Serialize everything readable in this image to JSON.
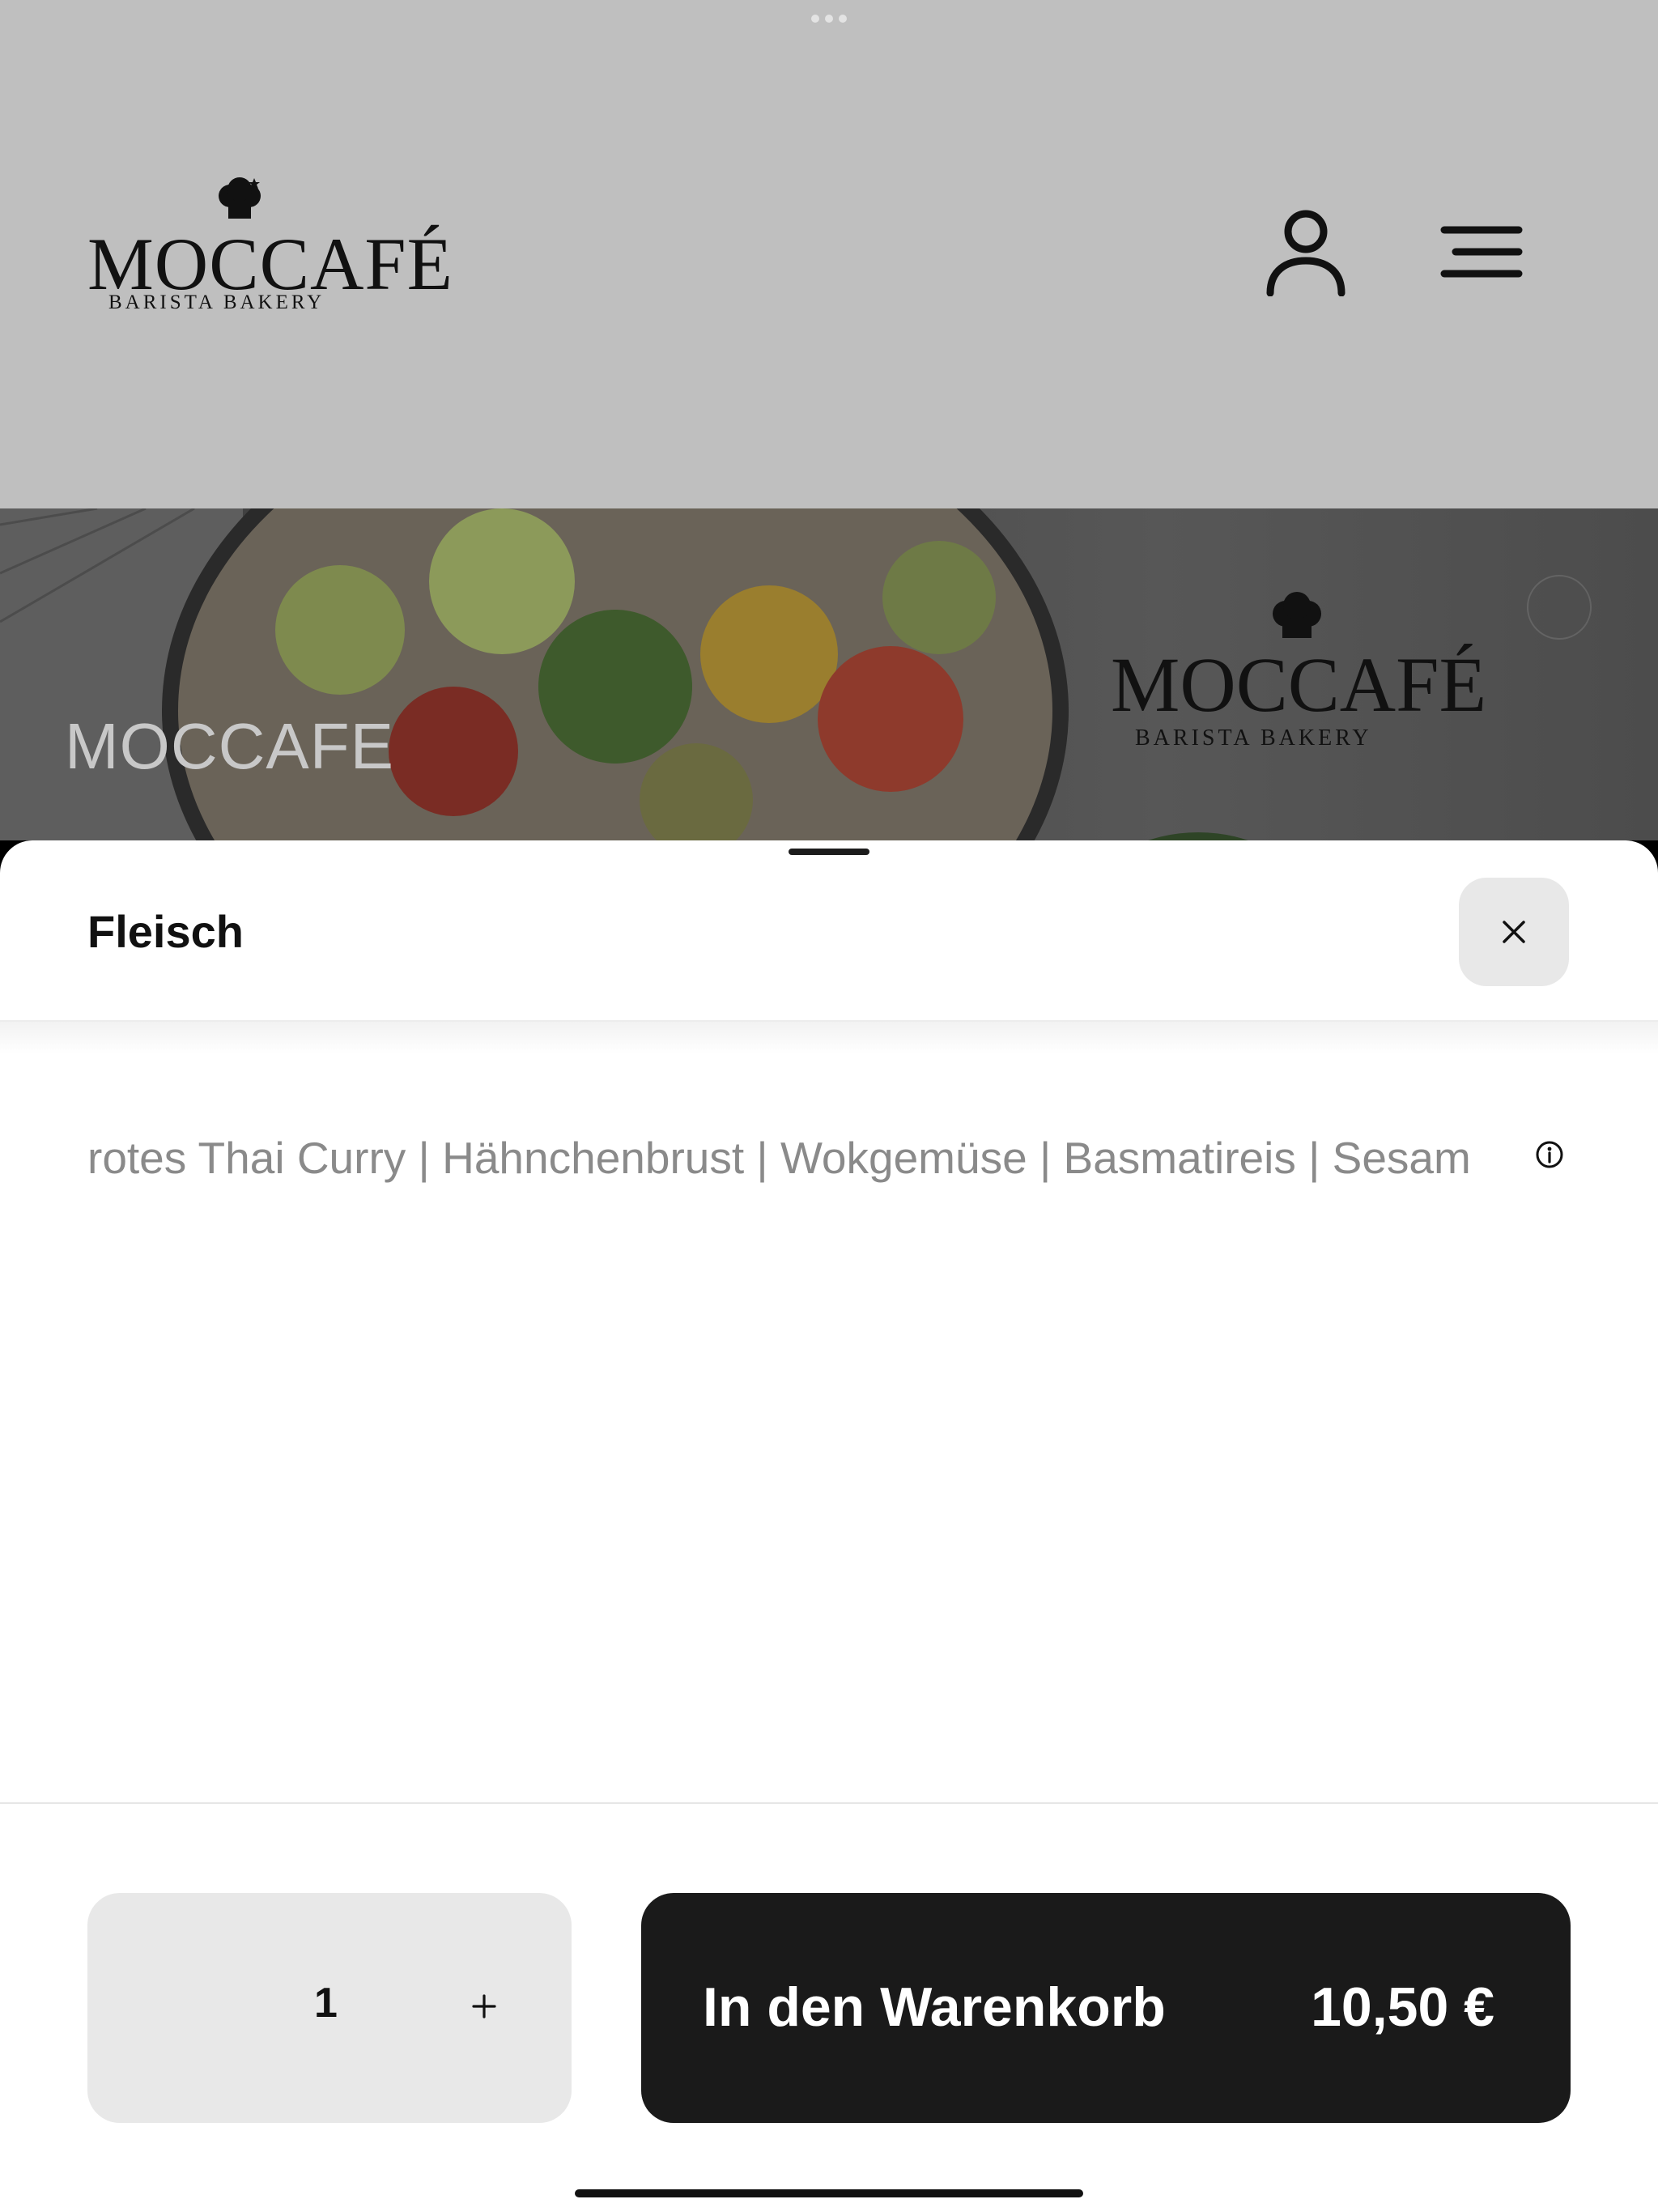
{
  "header": {
    "logo_text": "MOCCAFÉ",
    "logo_subtext": "BARISTA BAKERY",
    "account_icon": "user-icon",
    "menu_icon": "hamburger-menu-icon"
  },
  "hero": {
    "title": "MOCCAFE",
    "logo_text": "MOCCAFÉ",
    "logo_subtext": "BARISTA BAKERY"
  },
  "sheet": {
    "title": "Fleisch",
    "close_icon": "close-icon",
    "description": "rotes Thai Curry | Hähnchenbrust | Wokgemüse | Basmatireis | Sesam",
    "info_icon": "info-icon"
  },
  "footer": {
    "quantity": "1",
    "plus_label": "+",
    "add_to_cart_label": "In den Warenkorb",
    "price": "10,50 €"
  },
  "colors": {
    "header_bg": "#bfbfbf",
    "button_dark": "#1a1a1a",
    "button_light": "#e8e8e8",
    "text_muted": "#8a8a8a"
  }
}
